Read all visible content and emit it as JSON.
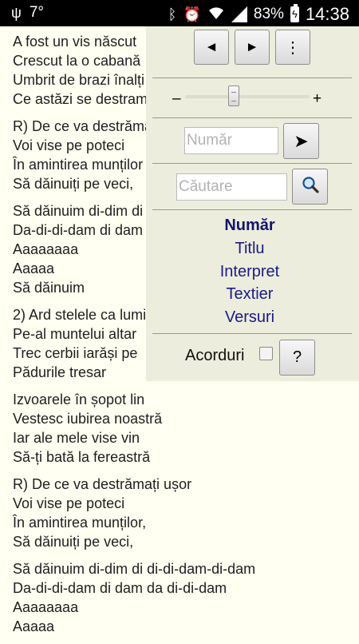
{
  "status_bar": {
    "usb_icon": "usb-icon",
    "temperature": "7°",
    "bluetooth_icon": "bluetooth-icon",
    "alarm_icon": "alarm-icon",
    "wifi_icon": "wifi-icon",
    "signal_icon": "signal-icon",
    "battery_percent": "83%",
    "time": "14:38"
  },
  "lyrics": {
    "stanzas": [
      [
        "A fost un vis născut",
        "Crescut la o cabană",
        "Umbrit de brazi înalți",
        "Ce astăzi se destramă"
      ],
      [
        "R) De ce va destrămați",
        "Voi vise pe poteci",
        "În amintirea munților",
        "Să dăinuiți pe veci,"
      ],
      [
        "Să dăinuim di-dim di",
        "Da-di-di-dam di dam",
        "Aaaaaaaa",
        "Aaaaa",
        "Să dăinuim"
      ],
      [
        "2) Ard stelele ca lumi",
        "Pe-al muntelui altar",
        "Trec cerbii iarăși pe",
        "Pădurile tresar"
      ],
      [
        "Izvoarele în șopot lin",
        "Vestesc iubirea noastră",
        "Iar ale mele vise vin",
        "Să-ți bată la fereastră"
      ],
      [
        "R) De ce va destrămați ușor",
        "Voi vise pe poteci",
        "În amintirea munților,",
        "Să dăinuiți pe veci,"
      ],
      [
        "Să dăinuim di-dim di di-di-dam-di-dam",
        "Da-di-di-dam di dam da di-di-dam",
        "Aaaaaaaa",
        "Aaaaa"
      ]
    ]
  },
  "panel": {
    "prev_label": "◄",
    "next_label": "►",
    "more_label": "⋮",
    "minus": "–",
    "plus": "+",
    "number_placeholder": "Număr",
    "go_label": "➤",
    "search_placeholder": "Căutare",
    "sort_options": [
      "Număr",
      "Titlu",
      "Interpret",
      "Textier",
      "Versuri"
    ],
    "selected_sort": "Număr",
    "chords_label": "Acorduri",
    "chords_checked": false,
    "help_label": "?"
  }
}
